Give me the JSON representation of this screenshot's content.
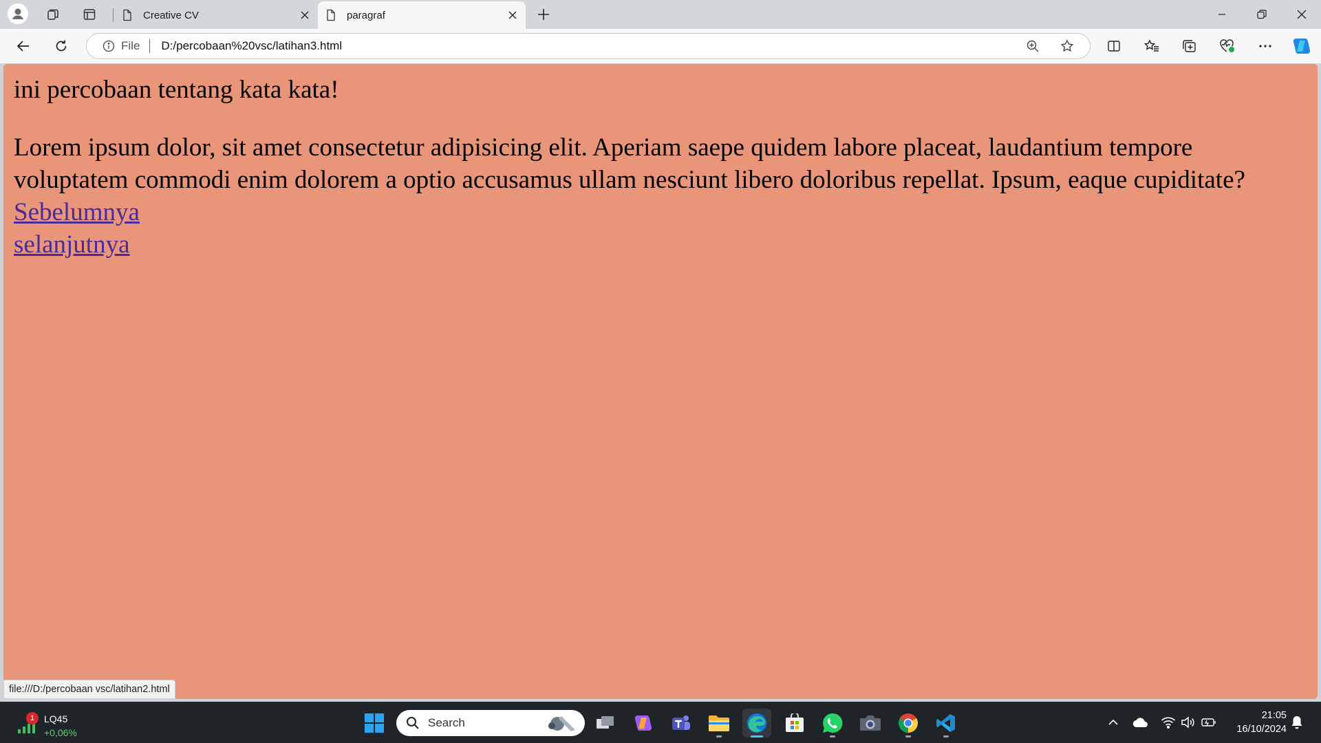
{
  "browser": {
    "tabs": [
      {
        "title": "Creative CV",
        "active": false
      },
      {
        "title": "paragraf",
        "active": true
      }
    ],
    "address": {
      "scheme_label": "File",
      "url": "D:/percobaan%20vsc/latihan3.html"
    },
    "status_url": "file:///D:/percobaan vsc/latihan2.html"
  },
  "page": {
    "heading": "ini percobaan tentang kata kata!",
    "paragraph": "Lorem ipsum dolor, sit amet consectetur adipisicing elit. Aperiam saepe quidem labore placeat, laudantium tempore voluptatem commodi enim dolorem a optio accusamus ullam nesciunt libero doloribus repellat. Ipsum, eaque cupiditate?",
    "links": [
      "Sebelumnya",
      "selanjutnya"
    ],
    "background_color": "#e9957a",
    "link_color": "#4b2b99"
  },
  "taskbar": {
    "widget": {
      "badge": "1",
      "title": "LQ45",
      "change": "+0,06%"
    },
    "search_label": "Search",
    "apps": [
      "task-view",
      "copilot",
      "teams",
      "file-explorer",
      "edge",
      "microsoft-store",
      "whatsapp",
      "camera",
      "chrome",
      "vscode"
    ],
    "active_app": "edge",
    "clock": {
      "time": "21:05",
      "date": "16/10/2024"
    }
  }
}
